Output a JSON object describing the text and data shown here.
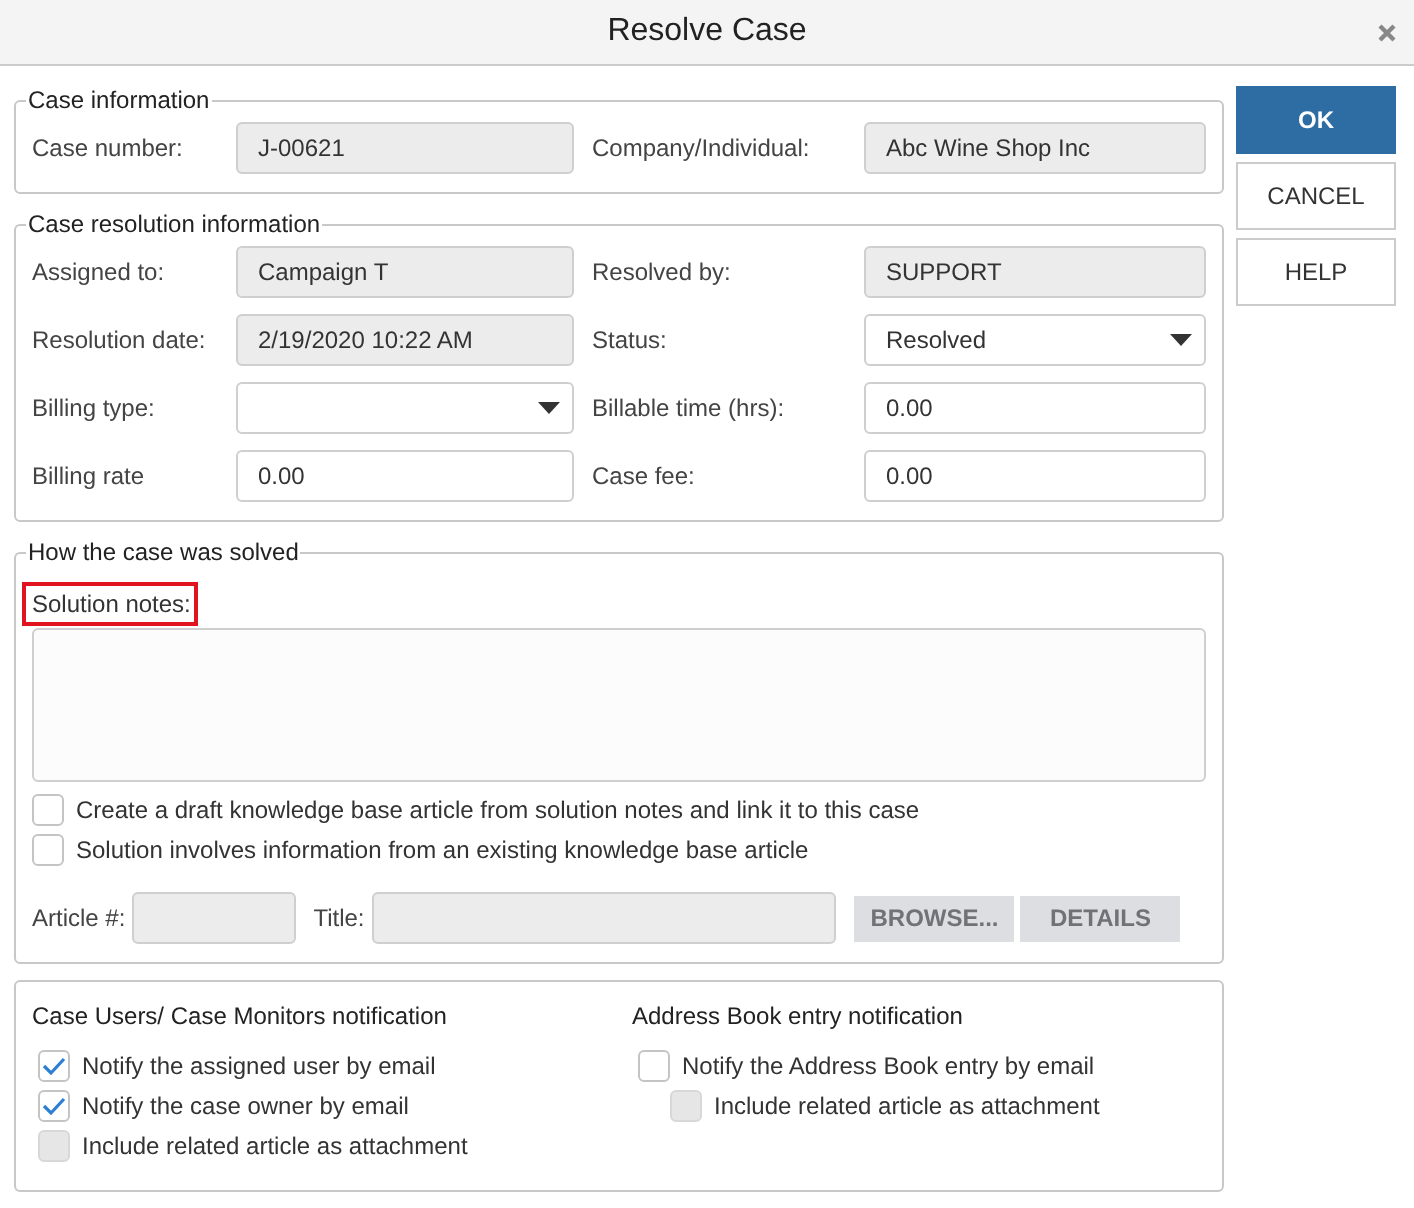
{
  "window": {
    "title": "Resolve Case"
  },
  "buttons": [
    {
      "label": "OK",
      "primary": true
    },
    {
      "label": "CANCEL",
      "primary": false
    },
    {
      "label": "HELP",
      "primary": false
    }
  ],
  "case_information": {
    "legend": "Case information",
    "fields": [
      {
        "label": "Case number:",
        "value": "J-00621",
        "kind": "readonly"
      },
      {
        "label": "Company/Individual:",
        "value": "Abc Wine Shop Inc",
        "kind": "readonly"
      }
    ]
  },
  "case_resolution": {
    "legend": "Case resolution information",
    "fields": [
      {
        "label": "Assigned to:",
        "value": "Campaign T",
        "kind": "readonly"
      },
      {
        "label": "Resolved by:",
        "value": "SUPPORT",
        "kind": "readonly"
      },
      {
        "label": "Resolution date:",
        "value": "2/19/2020 10:22 AM",
        "kind": "readonly"
      },
      {
        "label": "Status:",
        "value": "Resolved",
        "kind": "dropdown"
      },
      {
        "label": "Billing type:",
        "kind": "dropdown"
      },
      {
        "label": "Billable time (hrs):",
        "value": "0.00",
        "kind": "text"
      },
      {
        "label": "Billing rate",
        "value": "0.00",
        "kind": "text"
      },
      {
        "label": "Case fee:",
        "value": "0.00",
        "kind": "text"
      }
    ]
  },
  "how_solved": {
    "legend": "How the case was solved",
    "notes_label": "Solution notes:",
    "notes_highlighted": true,
    "options": [
      {
        "label": "Create a draft knowledge base article from solution notes and link it to this case",
        "checked": false,
        "disabled": false
      },
      {
        "label": "Solution involves information from an existing knowledge base article",
        "checked": false,
        "disabled": false
      }
    ],
    "article_label": "Article #:",
    "title_label": "Title:",
    "actions": [
      {
        "label": "BROWSE...",
        "disabled": true
      },
      {
        "label": "DETAILS",
        "disabled": true
      }
    ]
  },
  "notifications": {
    "groups": [
      {
        "heading": "Case Users/ Case Monitors notification",
        "options": [
          {
            "label": "Notify the assigned user by email",
            "checked": true,
            "disabled": false
          },
          {
            "label": "Notify the case owner by email",
            "checked": true,
            "disabled": false
          },
          {
            "label": "Include related article as attachment",
            "checked": false,
            "disabled": true
          }
        ]
      },
      {
        "heading": "Address Book entry notification",
        "options": [
          {
            "label": "Notify the Address Book entry by email",
            "checked": false,
            "disabled": false,
            "children": [
              {
                "label": "Include related article as attachment",
                "checked": false,
                "disabled": true
              }
            ]
          }
        ]
      }
    ]
  }
}
